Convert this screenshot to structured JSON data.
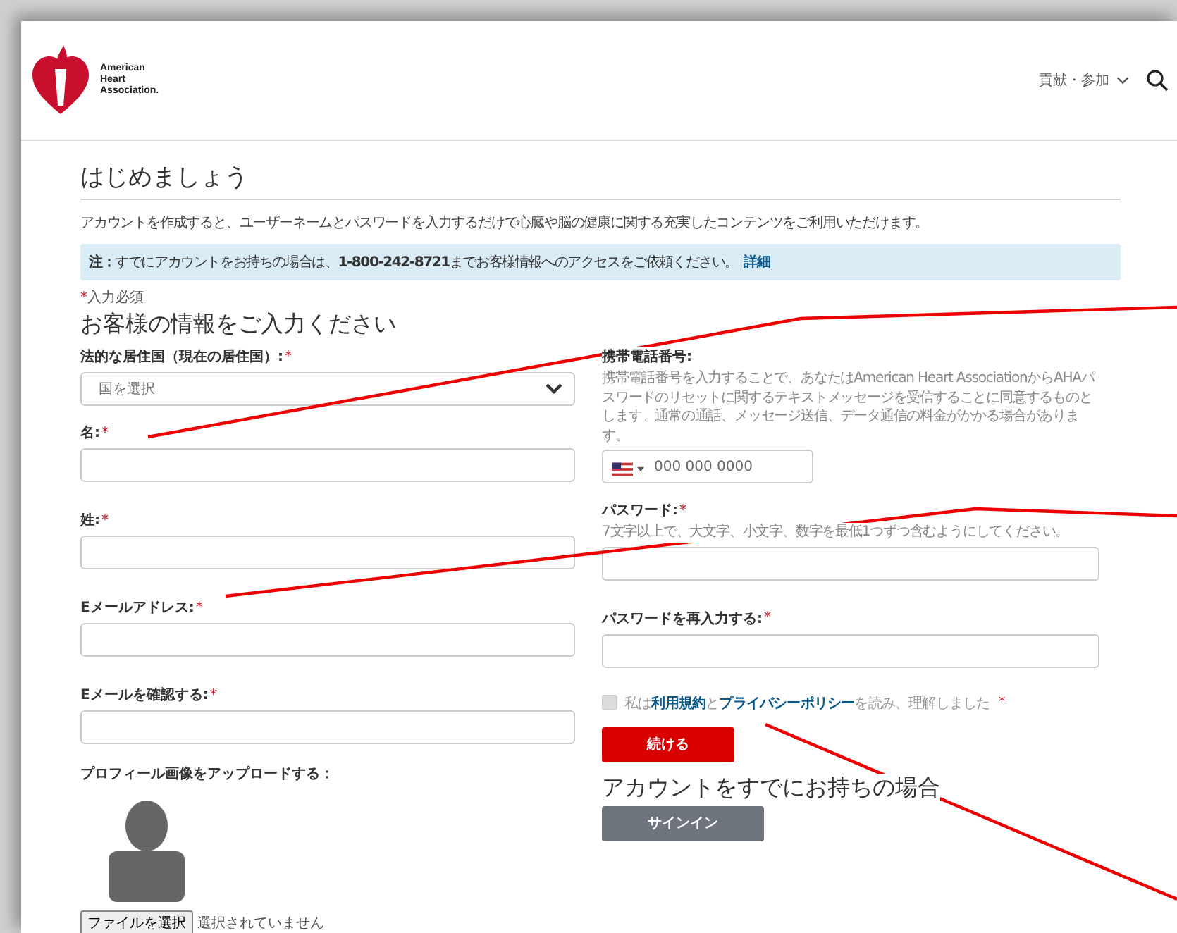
{
  "header": {
    "logo_lines": [
      "American",
      "Heart",
      "Association."
    ],
    "nav_item": {
      "label": "貢献・参加"
    }
  },
  "title": "はじめましょう",
  "intro": "アカウントを作成すると、ユーザーネームとパスワードを入力するだけで心臓や脳の健康に関する充実したコンテンツをご利用いただけます。",
  "note": {
    "text": "**注：**すでにアカウントをお持ちの場合は、**1-800-242-8721**までお客様情報へのアクセスをご依頼ください。",
    "link": "詳細"
  },
  "required_note": {
    "mark": "*",
    "text": "入力必須"
  },
  "form_heading": "お客様の情報をご入力ください",
  "left_fields": [
    {
      "kind": "select",
      "label": "法的な居住国（現在の居住国）:",
      "required": true,
      "placeholder": "国を選択"
    },
    {
      "kind": "text",
      "label": "名:",
      "required": true
    },
    {
      "kind": "text",
      "label": "姓:",
      "required": true
    },
    {
      "kind": "text",
      "label": "Eメールアドレス:",
      "required": true
    },
    {
      "kind": "text",
      "label": "Eメールを確認する:",
      "required": true
    }
  ],
  "upload": {
    "label": "プロフィール画像をアップロードする：",
    "button": "ファイルを選択",
    "status": "選択されていません"
  },
  "right_fields": [
    {
      "kind": "phone",
      "label": "携帯電話番号:",
      "required": false,
      "hint": "携帯電話番号を入力することで、あなたはAmerican Heart AssociationからAHAパスワードのリセットに関するテキストメッセージを受信することに同意するものとします。通常の通話、メッセージ送信、データ通信の料金がかかる場合があります。",
      "placeholder": "000 000 0000"
    },
    {
      "kind": "text",
      "label": "パスワード:",
      "required": true,
      "hint": "7文字以上で、大文字、小文字、数字を最低1つずつ含むようにしてください。"
    },
    {
      "kind": "text",
      "label": "パスワードを再入力する:",
      "required": true
    }
  ],
  "consent": {
    "checked": false,
    "required": true,
    "parts": [
      {
        "kind": "text",
        "text": "私は"
      },
      {
        "kind": "link",
        "text": "利用規約"
      },
      {
        "kind": "text",
        "text": "と"
      },
      {
        "kind": "link",
        "text": "プライバシーポリシー"
      },
      {
        "kind": "text",
        "text": "を読み、理解しました"
      }
    ]
  },
  "continue_button": "続ける",
  "signin_heading": "アカウントをすでにお持ちの場合",
  "signin_button": "サインイン"
}
